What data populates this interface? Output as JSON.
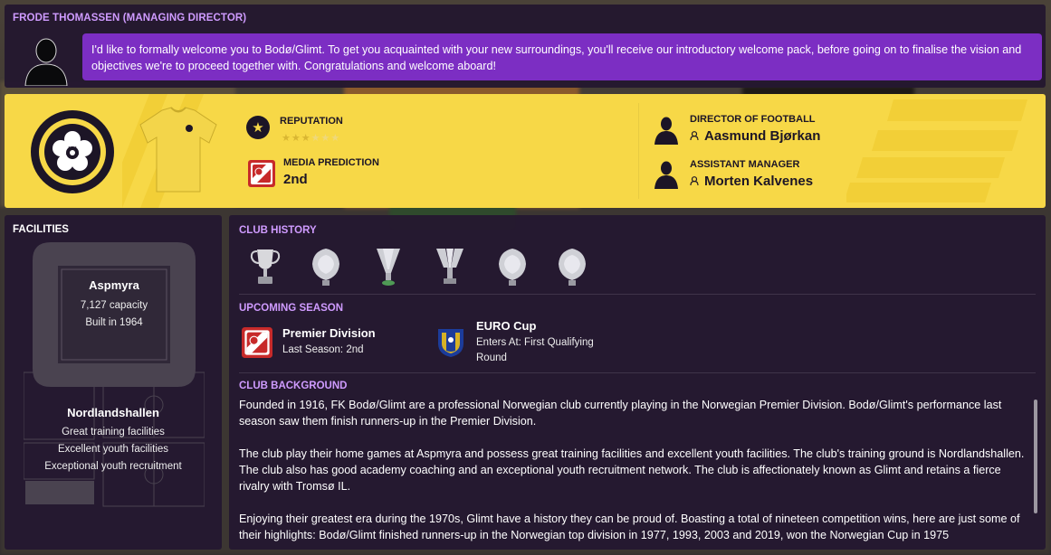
{
  "message": {
    "sender": "FRODE THOMASSEN (MANAGING DIRECTOR)",
    "text": "I'd like to formally welcome you to Bodø/Glimt. To get you acquainted with your new surroundings, you'll receive our introductory welcome pack, before going on to finalise the vision and objectives we're to proceed together with. Congratulations and welcome aboard!"
  },
  "club": {
    "reputation_label": "REPUTATION",
    "reputation_stars": 3,
    "reputation_max": 6,
    "media_label": "MEDIA PREDICTION",
    "media_value": "2nd",
    "dof_label": "DIRECTOR OF FOOTBALL",
    "dof_name": "Aasmund Bjørkan",
    "am_label": "ASSISTANT MANAGER",
    "am_name": "Morten Kalvenes",
    "colors": {
      "primary": "#f7d847",
      "secondary": "#1c1526",
      "accent_purple": "#7c2ec3"
    }
  },
  "facilities": {
    "title": "FACILITIES",
    "stadium": {
      "name": "Aspmyra",
      "capacity": "7,127 capacity",
      "built": "Built in 1964"
    },
    "training": {
      "name": "Nordlandshallen",
      "lines": [
        "Great training facilities",
        "Excellent youth facilities",
        "Exceptional youth recruitment"
      ]
    }
  },
  "history": {
    "title": "CLUB HISTORY",
    "trophies": [
      "cup-trophy-icon",
      "shield-trophy-icon",
      "goblet-trophy-icon",
      "european-trophy-icon",
      "shield-trophy-icon",
      "shield-trophy-icon"
    ]
  },
  "season": {
    "title": "UPCOMING SEASON",
    "league": {
      "name": "Premier Division",
      "sub": "Last Season: 2nd"
    },
    "euro": {
      "name": "EURO Cup",
      "sub": "Enters At: First Qualifying Round"
    }
  },
  "background": {
    "title": "CLUB BACKGROUND",
    "paragraphs": [
      "Founded in 1916, FK Bodø/Glimt are a professional Norwegian club currently playing in the Norwegian Premier Division. Bodø/Glimt's performance last season saw them finish runners-up in the Premier Division.",
      "The club play their home games at Aspmyra and possess great training facilities and excellent youth facilities. The club's training ground is Nordlandshallen. The club also has good academy coaching and an exceptional youth recruitment network. The club is affectionately known as Glimt and retains a fierce rivalry with Tromsø IL.",
      "Enjoying their greatest era during the 1970s, Glimt have a history they can be proud of. Boasting a total of nineteen competition wins, here are just some of their highlights: Bodø/Glimt finished runners-up in the Norwegian top division in 1977, 1993, 2003 and 2019, won the Norwegian Cup in 1975"
    ]
  }
}
